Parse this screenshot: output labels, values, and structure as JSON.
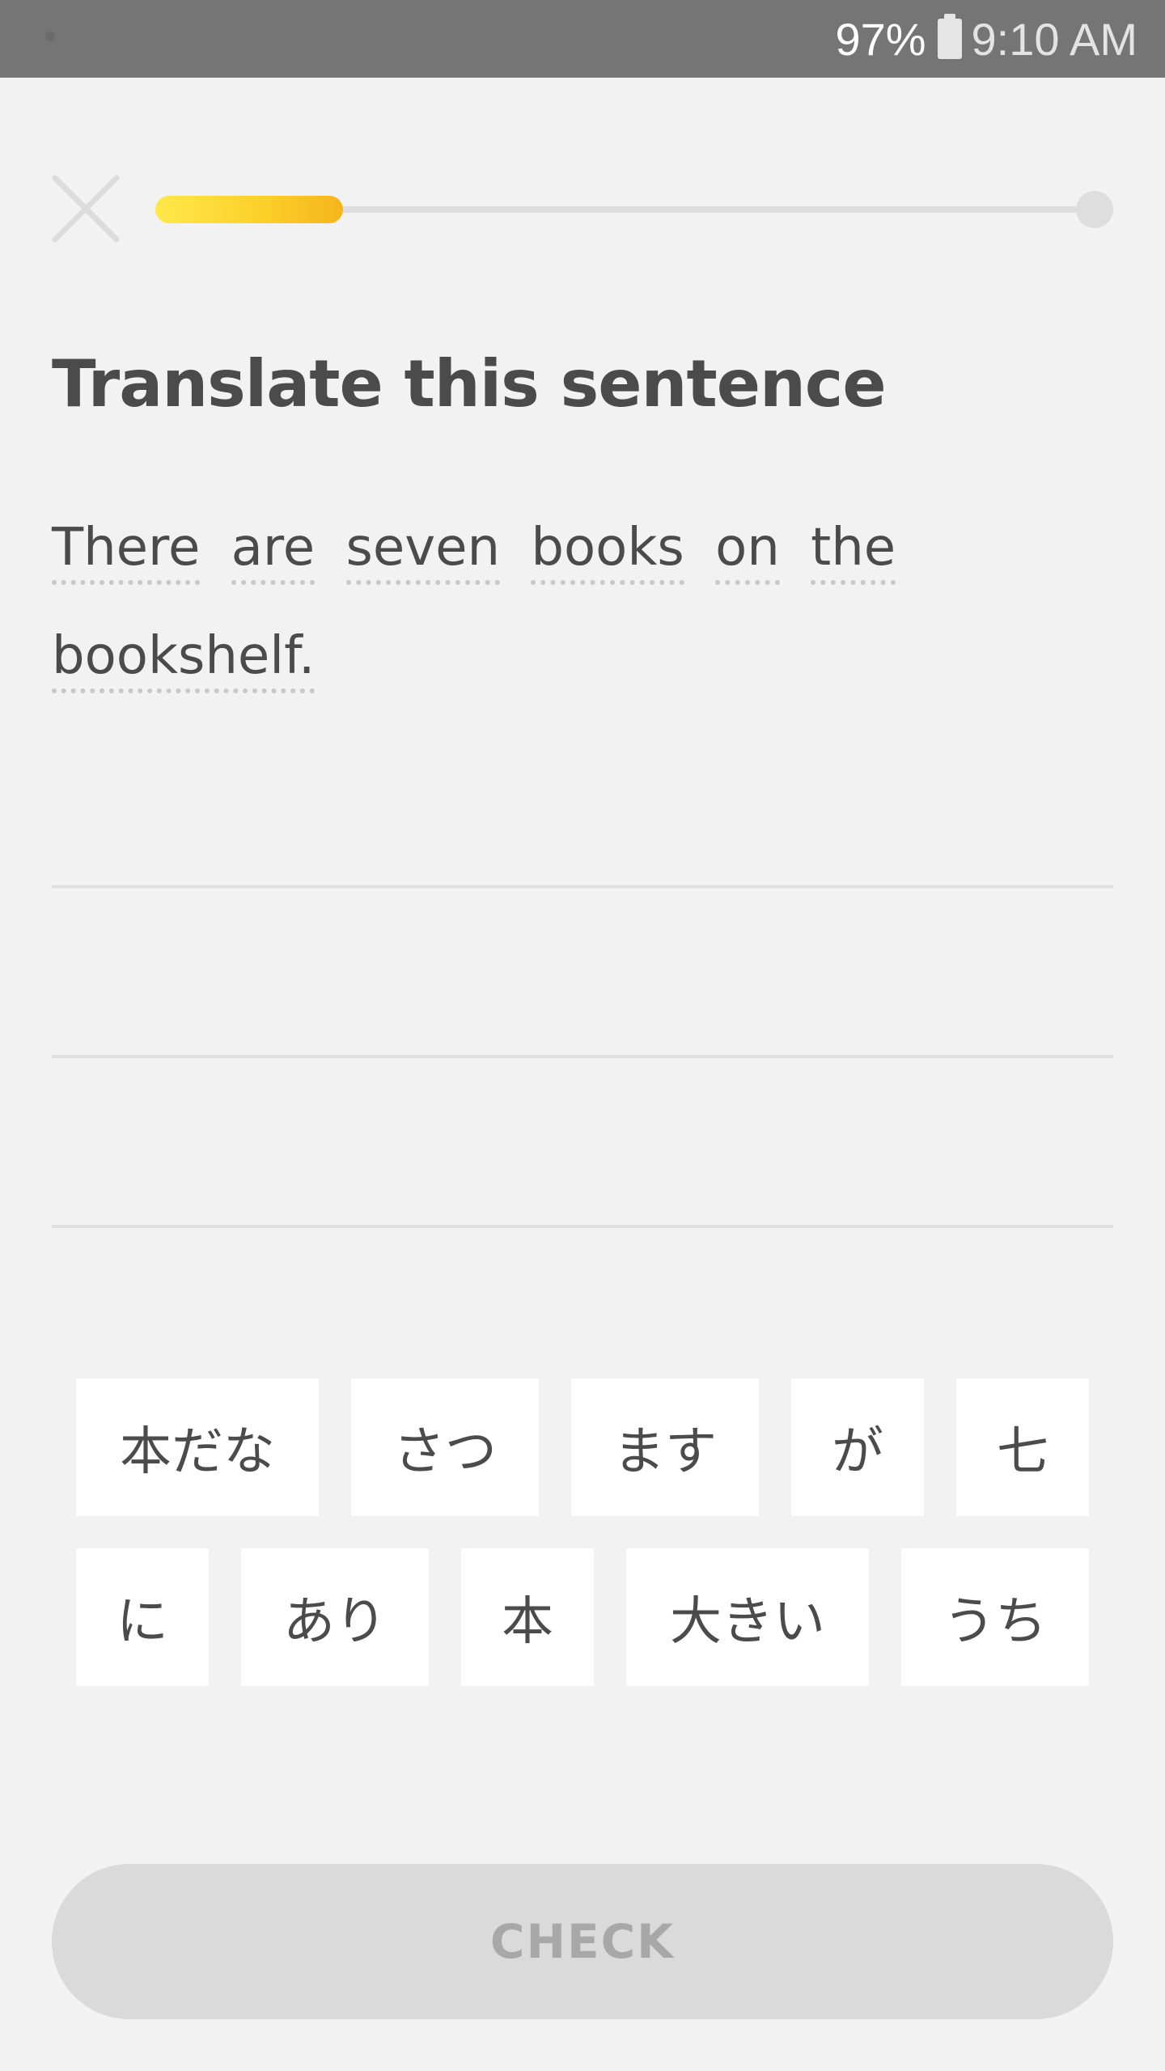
{
  "status_bar": {
    "battery_percent": "97%",
    "battery_icon": "battery-icon",
    "time": "9:10 AM",
    "color": "#757575"
  },
  "header": {
    "close_icon": "close-icon",
    "progress": 0.2
  },
  "exercise": {
    "title": "Translate this sentence",
    "sentence_words": [
      "There",
      "are",
      "seven",
      "books",
      "on",
      "the",
      "bookshelf."
    ]
  },
  "word_bank": {
    "rows": [
      [
        "本だな",
        "さつ",
        "ます",
        "が",
        "七"
      ],
      [
        "に",
        "あり",
        "本",
        "大きい",
        "うち"
      ]
    ]
  },
  "footer": {
    "check_label": "CHECK"
  },
  "colors": {
    "accent": "#fcd12a",
    "text": "#4b4b4b",
    "disabled_button": "#dadada"
  }
}
